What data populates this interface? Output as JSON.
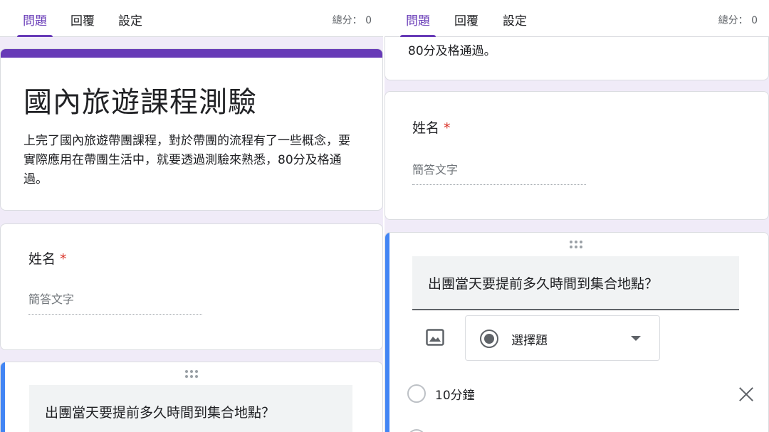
{
  "tabs": [
    {
      "label": "問題",
      "active": true
    },
    {
      "label": "回覆",
      "active": false
    },
    {
      "label": "設定",
      "active": false
    }
  ],
  "score_label": "總分：",
  "score_value": "0",
  "form": {
    "title": "國內旅遊課程測驗",
    "description": "上完了國內旅遊帶團課程，對於帶團的流程有了一些概念，要實際應用在帶團生活中，就要透過測驗來熟悉，80分及格通過。",
    "description_tail": "80分及格通過。"
  },
  "questions": [
    {
      "label": "姓名",
      "required_mark": "*",
      "answer_placeholder": "簡答文字"
    },
    {
      "label": "出團當天要提前多久時間到集合地點？",
      "type_label": "選擇題",
      "options": [
        "10分鐘"
      ]
    }
  ],
  "colors": {
    "accent": "#673ab7",
    "active_bar": "#4285f4",
    "required": "#d93025"
  },
  "icons": [
    "drag-handle-icon",
    "image-icon",
    "radio-icon",
    "chevron-down-icon",
    "close-icon"
  ]
}
